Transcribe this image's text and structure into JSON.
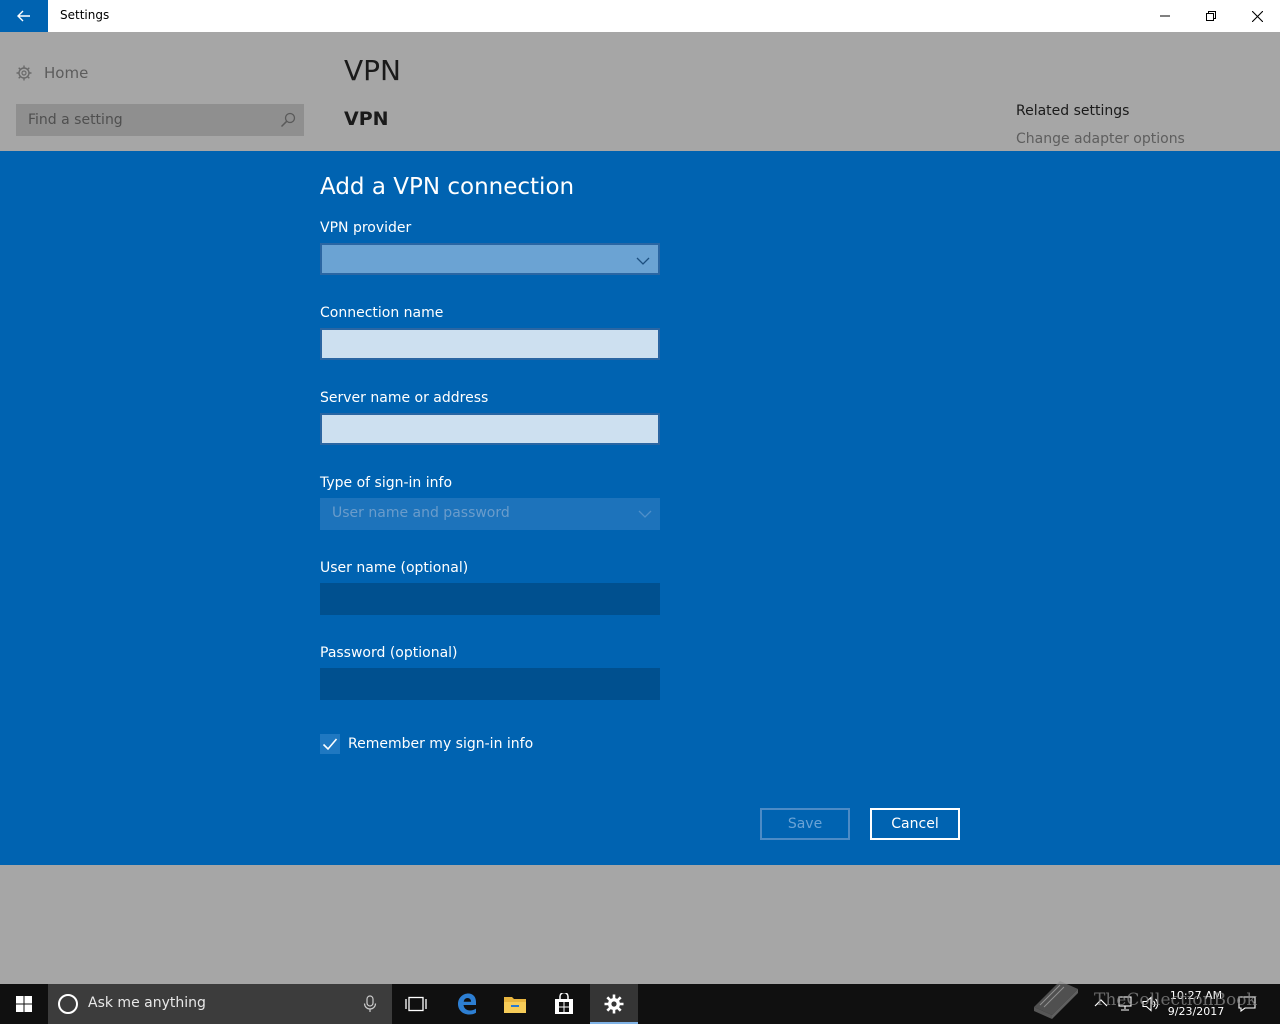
{
  "window": {
    "title": "Settings",
    "back_icon": "arrow-left-icon",
    "minimize_icon": "minimize-icon",
    "maximize_icon": "restore-icon",
    "close_icon": "close-icon"
  },
  "sidebar": {
    "home_label": "Home",
    "home_icon": "gear-icon",
    "search_placeholder": "Find a setting",
    "search_icon": "search-icon"
  },
  "main": {
    "page_title": "VPN",
    "section_title": "VPN"
  },
  "related": {
    "title": "Related settings",
    "link": "Change adapter options"
  },
  "dialog": {
    "title": "Add a VPN connection",
    "vpn_provider": {
      "label": "VPN provider",
      "value": ""
    },
    "connection_name": {
      "label": "Connection name",
      "value": ""
    },
    "server": {
      "label": "Server name or address",
      "value": ""
    },
    "signin_type": {
      "label": "Type of sign-in info",
      "value": "User name and password"
    },
    "username": {
      "label": "User name (optional)",
      "value": ""
    },
    "password": {
      "label": "Password (optional)",
      "value": ""
    },
    "remember": {
      "label": "Remember my sign-in info",
      "checked": true
    },
    "save_label": "Save",
    "cancel_label": "Cancel"
  },
  "taskbar": {
    "search_placeholder": "Ask me anything",
    "clock_time": "10:27 AM",
    "clock_date": "9/23/2017"
  },
  "watermark": {
    "text": "TheCollectionBook"
  },
  "colors": {
    "accent": "#0063b1",
    "taskbar": "#101010",
    "dim_overlay": "#a6a6a6"
  }
}
